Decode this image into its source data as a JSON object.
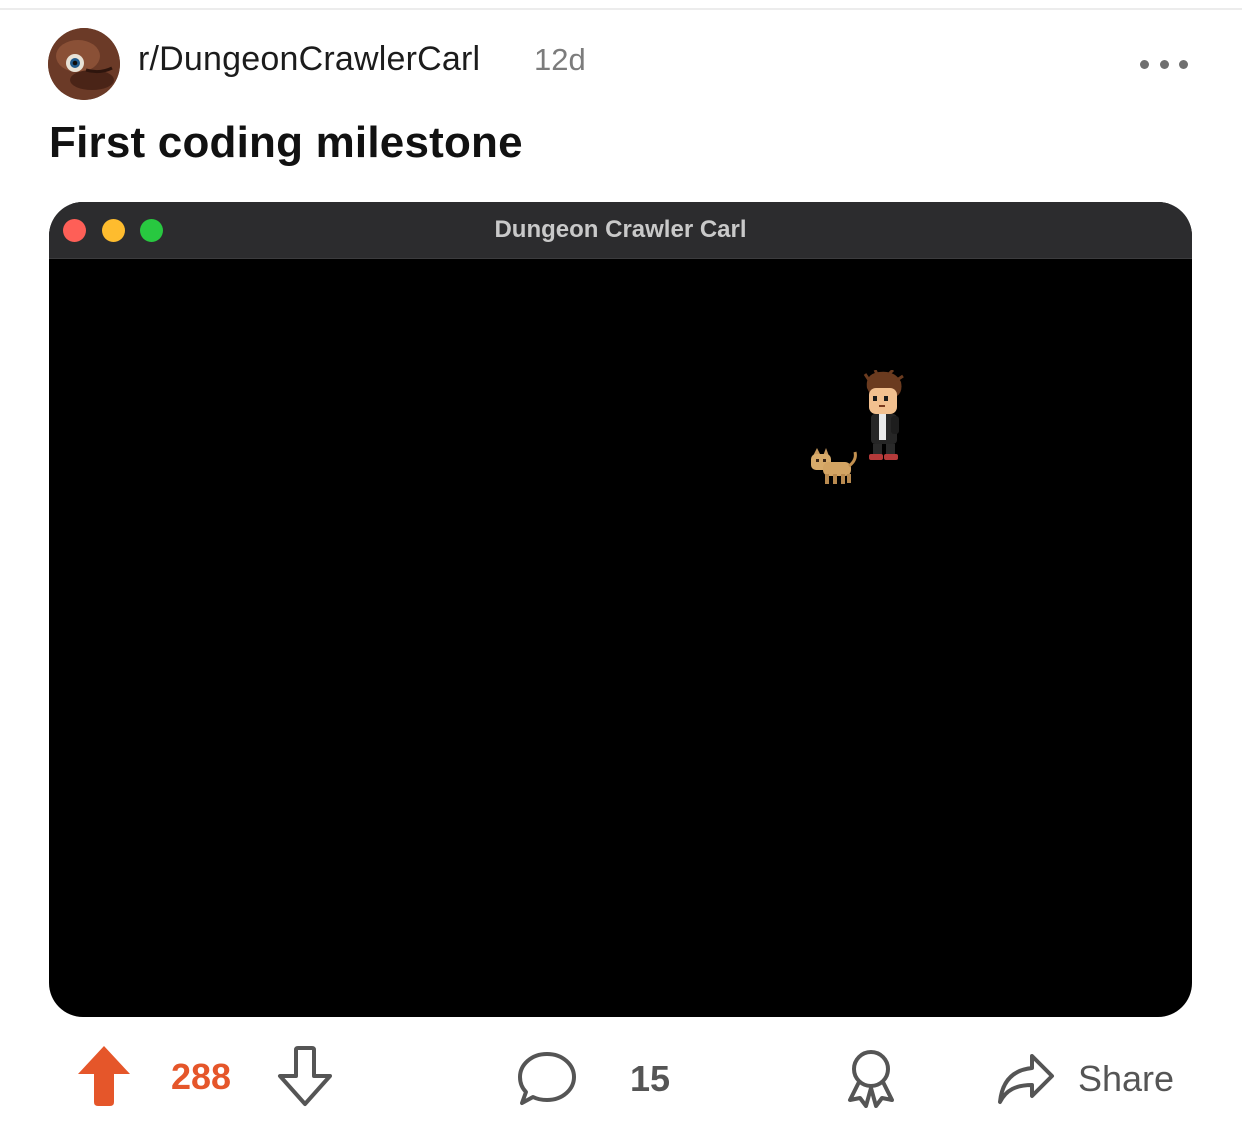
{
  "post": {
    "subreddit": "r/DungeonCrawlerCarl",
    "age": "12d",
    "title": "First coding milestone"
  },
  "window": {
    "title": "Dungeon Crawler Carl"
  },
  "actions": {
    "upvotes": "288",
    "comments": "15",
    "share_label": "Share"
  },
  "icons": {
    "avatar": "subreddit-avatar",
    "more": "more-horizontal-icon",
    "upvote": "upvote-arrow-icon",
    "downvote": "downvote-arrow-icon",
    "comment": "comment-bubble-icon",
    "award": "award-icon",
    "share": "share-arrow-icon"
  },
  "colors": {
    "upvote_active": "#e5562a",
    "window_bg": "#000000",
    "titlebar": "#2c2c2e"
  }
}
